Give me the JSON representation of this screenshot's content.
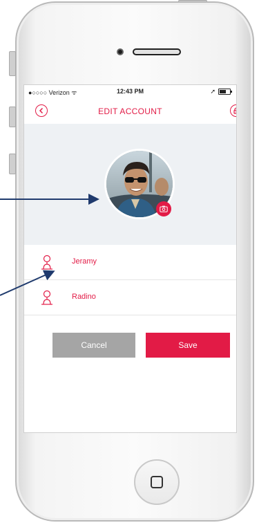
{
  "status_bar": {
    "carrier": "●○○○○ Verizon ᯤ",
    "time": "12:43 PM",
    "location_glyph": "➚"
  },
  "nav": {
    "title": "EDIT ACCOUNT",
    "back_icon": "chevron-left-icon",
    "lock_icon": "lock-icon"
  },
  "profile": {
    "avatar_icon": "profile-photo",
    "camera_icon": "camera-icon"
  },
  "fields": [
    {
      "value": "Jeramy",
      "icon": "user-icon"
    },
    {
      "value": "Radino",
      "icon": "user-icon"
    }
  ],
  "buttons": {
    "cancel_label": "Cancel",
    "save_label": "Save"
  },
  "colors": {
    "accent": "#e21b46",
    "cancel": "#a5a5a5",
    "header_bg": "#eef1f4",
    "annotation_arrow": "#1f3a6d"
  }
}
